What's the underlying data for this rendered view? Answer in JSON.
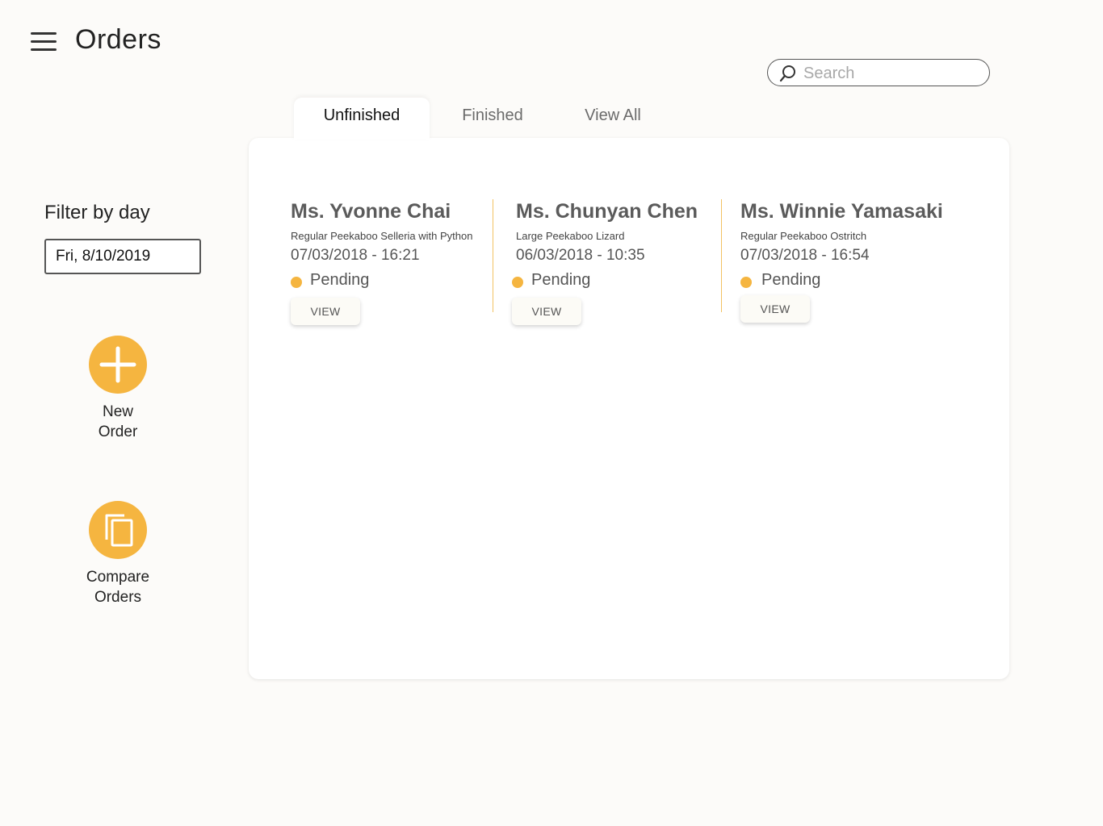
{
  "header": {
    "title": "Orders",
    "menu_icon": "hamburger-menu-icon"
  },
  "search": {
    "placeholder": "Search",
    "value": "",
    "icon": "search-icon"
  },
  "tabs": [
    {
      "label": "Unfinished",
      "active": true
    },
    {
      "label": "Finished",
      "active": false
    },
    {
      "label": "View All",
      "active": false
    }
  ],
  "sidebar": {
    "filter_label": "Filter by day",
    "date_value": "Fri, 8/10/2019",
    "actions": [
      {
        "label": "New\nOrder",
        "icon": "plus-icon"
      },
      {
        "label": "Compare\nOrders",
        "icon": "copy-icon"
      }
    ]
  },
  "orders": [
    {
      "name": "Ms. Yvonne Chai",
      "product": "Regular Peekaboo Selleria with Python",
      "datetime": "07/03/2018 - 16:21",
      "status": "Pending",
      "button": "VIEW"
    },
    {
      "name": "Ms. Chunyan Chen",
      "product": "Large Peekaboo Lizard",
      "datetime": "06/03/2018 - 10:35",
      "status": "Pending",
      "button": "VIEW"
    },
    {
      "name": "Ms. Winnie Yamasaki",
      "product": "Regular Peekaboo Ostritch",
      "datetime": "07/03/2018 - 16:54",
      "status": "Pending",
      "button": "VIEW"
    }
  ],
  "colors": {
    "accent": "#f5b540",
    "background": "#fcfbf9",
    "panel": "#ffffff",
    "divider": "#f2c263"
  }
}
